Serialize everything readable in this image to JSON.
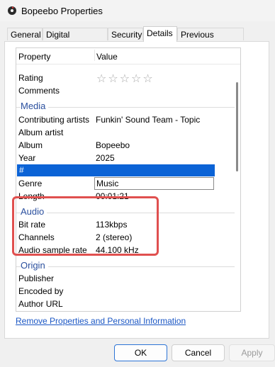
{
  "window": {
    "title": "Bopeebo Properties"
  },
  "tabs": [
    "General",
    "Digital Signatures",
    "Security",
    "Details",
    "Previous Versions"
  ],
  "table": {
    "col_property": "Property",
    "col_value": "Value"
  },
  "rows": {
    "rating": "Rating",
    "rating_stars": "☆☆☆☆☆",
    "comments": "Comments",
    "media": "Media",
    "contributing_artists": "Contributing artists",
    "contributing_artists_value": "Funkin' Sound Team - Topic",
    "album_artist": "Album artist",
    "album": "Album",
    "album_value": "Bopeebo",
    "year": "Year",
    "year_value": "2025",
    "track": "#",
    "genre": "Genre",
    "genre_value": "Music",
    "length": "Length",
    "length_value": "00:01:21",
    "audio": "Audio",
    "bit_rate": "Bit rate",
    "bit_rate_value": "113kbps",
    "channels": "Channels",
    "channels_value": "2 (stereo)",
    "audio_sample_rate": "Audio sample rate",
    "audio_sample_rate_value": "44.100 kHz",
    "origin": "Origin",
    "publisher": "Publisher",
    "encoded_by": "Encoded by",
    "author_url": "Author URL"
  },
  "link": "Remove Properties and Personal Information",
  "buttons": {
    "ok": "OK",
    "cancel": "Cancel",
    "apply": "Apply"
  },
  "colors": {
    "selection": "#0b63d6",
    "group_label": "#2a4f9e",
    "highlight": "#e0504f",
    "link": "#1a56c4"
  }
}
